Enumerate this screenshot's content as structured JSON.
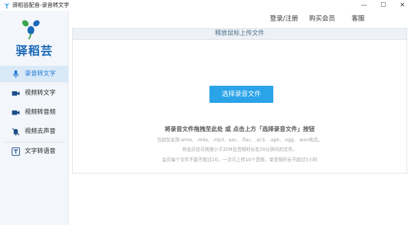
{
  "window": {
    "title": "驿稻芸配音-录音转文字",
    "minimize_glyph": "—",
    "maximize_glyph": "☐",
    "close_glyph": "✕"
  },
  "header": {
    "login": "登录/注册",
    "buy_vip": "购买会员",
    "service": "客服"
  },
  "sidebar": {
    "logo_text": "驿稻芸",
    "items": [
      {
        "label": "录音转文字",
        "icon": "microphone-icon",
        "active": true
      },
      {
        "label": "视频转文字",
        "icon": "video-camera-icon",
        "active": false
      },
      {
        "label": "视频转音频",
        "icon": "video-camera-icon",
        "active": false
      },
      {
        "label": "视频去声音",
        "icon": "mute-bell-icon",
        "active": false
      },
      {
        "label": "文字转语音",
        "icon": "text-t-icon",
        "active": false
      }
    ]
  },
  "main": {
    "drop_header": "释放鼠标上传文件",
    "select_button": "选择录音文件",
    "hint_main": "将录音文件拖拽至此处 或 点击上方「选择录音文件」按钮",
    "hint_formats": "当前仅支持.wma、.m4a、.mp3、aac、.flac、.ac3、.ape、.ogg、.wav格式。",
    "hint_nonmember": "非会员仅可转换小于20M且音频时长在20分钟内的文件。",
    "hint_member": "会员每个文件不能不超过1G，一次可上传10个音频，单音频时长不超过5小时"
  },
  "colors": {
    "accent": "#2aa3e8",
    "brand": "#1c6ab8",
    "active_nav_bg": "#d9e9f8"
  }
}
